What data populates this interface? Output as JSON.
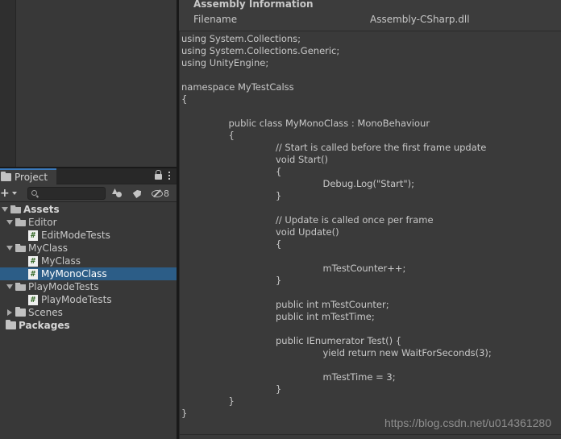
{
  "project_panel": {
    "tab_label": "Project",
    "hidden_count": "8",
    "search_placeholder": "",
    "tree": [
      {
        "label": "Assets",
        "depth": 0,
        "expanded": true,
        "type": "folder",
        "bold": true
      },
      {
        "label": "Editor",
        "depth": 1,
        "expanded": true,
        "type": "folder"
      },
      {
        "label": "EditModeTests",
        "depth": 2,
        "type": "script"
      },
      {
        "label": "MyClass",
        "depth": 1,
        "expanded": true,
        "type": "folder"
      },
      {
        "label": "MyClass",
        "depth": 2,
        "type": "script"
      },
      {
        "label": "MyMonoClass",
        "depth": 2,
        "type": "script",
        "selected": true
      },
      {
        "label": "PlayModeTests",
        "depth": 1,
        "expanded": true,
        "type": "folder"
      },
      {
        "label": "PlayModeTests",
        "depth": 2,
        "type": "script"
      },
      {
        "label": "Scenes",
        "depth": 1,
        "expanded": false,
        "type": "folder"
      },
      {
        "label": "Packages",
        "depth": 0,
        "type": "folder",
        "bold": true
      }
    ]
  },
  "inspector": {
    "title": "Assembly Information",
    "filename_label": "Filename",
    "filename_value": "Assembly-CSharp.dll",
    "code": "using System.Collections;\nusing System.Collections.Generic;\nusing UnityEngine;\n\nnamespace MyTestCalss\n{\n\n\t\t\t\tpublic class MyMonoClass : MonoBehaviour\n\t\t\t\t{\n\t\t\t\t\t\t\t\t// Start is called before the first frame update\n\t\t\t\t\t\t\t\tvoid Start()\n\t\t\t\t\t\t\t\t{\n\t\t\t\t\t\t\t\t\t\t\t\tDebug.Log(\"Start\");\n\t\t\t\t\t\t\t\t}\n\n\t\t\t\t\t\t\t\t// Update is called once per frame\n\t\t\t\t\t\t\t\tvoid Update()\n\t\t\t\t\t\t\t\t{\n\n\t\t\t\t\t\t\t\t\t\t\t\tmTestCounter++;\n\t\t\t\t\t\t\t\t}\n\n\t\t\t\t\t\t\t\tpublic int mTestCounter;\n\t\t\t\t\t\t\t\tpublic int mTestTime;\n\n\t\t\t\t\t\t\t\tpublic IEnumerator Test() {\n\t\t\t\t\t\t\t\t\t\t\t\tyield return new WaitForSeconds(3);\n\n\t\t\t\t\t\t\t\t\t\t\t\tmTestTime = 3;\n\t\t\t\t\t\t\t\t}\n\t\t\t\t}\n}"
  },
  "watermark": "https://blog.csdn.net/u014361280",
  "colors": {
    "selection": "#2c5d87",
    "tab_accent": "#3a79bb",
    "panel_bg": "#383838"
  }
}
